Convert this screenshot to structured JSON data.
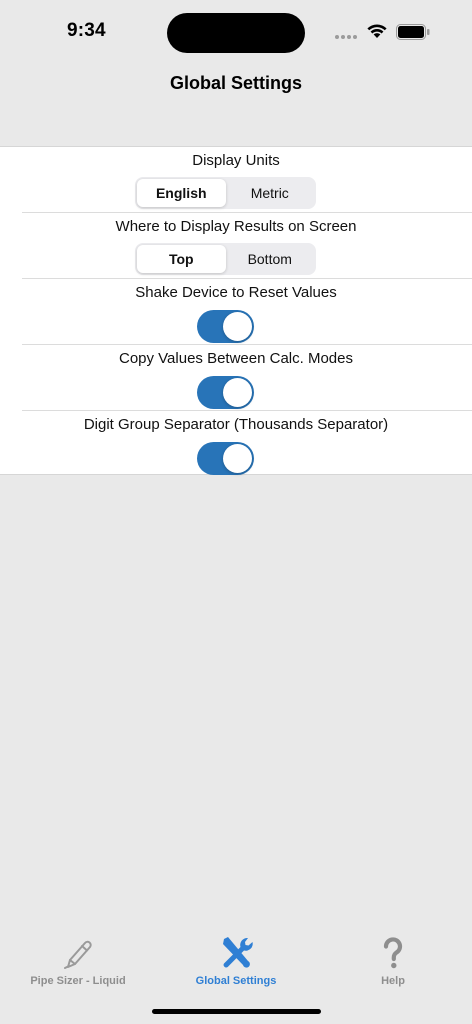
{
  "status_bar": {
    "time": "9:34"
  },
  "nav": {
    "title": "Global Settings"
  },
  "settings": {
    "display_units": {
      "label": "Display Units",
      "options": [
        "English",
        "Metric"
      ],
      "selected": "English"
    },
    "results_position": {
      "label": "Where to Display Results on Screen",
      "options": [
        "Top",
        "Bottom"
      ],
      "selected": "Top"
    },
    "shake_reset": {
      "label": "Shake Device to Reset Values",
      "on": true
    },
    "copy_values": {
      "label": "Copy Values Between Calc. Modes",
      "on": true
    },
    "digit_separator": {
      "label": "Digit Group Separator (Thousands Separator)",
      "on": true
    }
  },
  "tabbar": {
    "items": [
      {
        "label": "Pipe Sizer - Liquid",
        "icon": "pencil-icon",
        "active": false
      },
      {
        "label": "Global Settings",
        "icon": "tools-icon",
        "active": true
      },
      {
        "label": "Help",
        "icon": "question-mark-icon",
        "active": false
      }
    ]
  },
  "colors": {
    "accent": "#2874b8",
    "tab_active": "#2f7fd4",
    "tab_inactive": "#8e8e8e",
    "background": "#e9e9e9"
  }
}
